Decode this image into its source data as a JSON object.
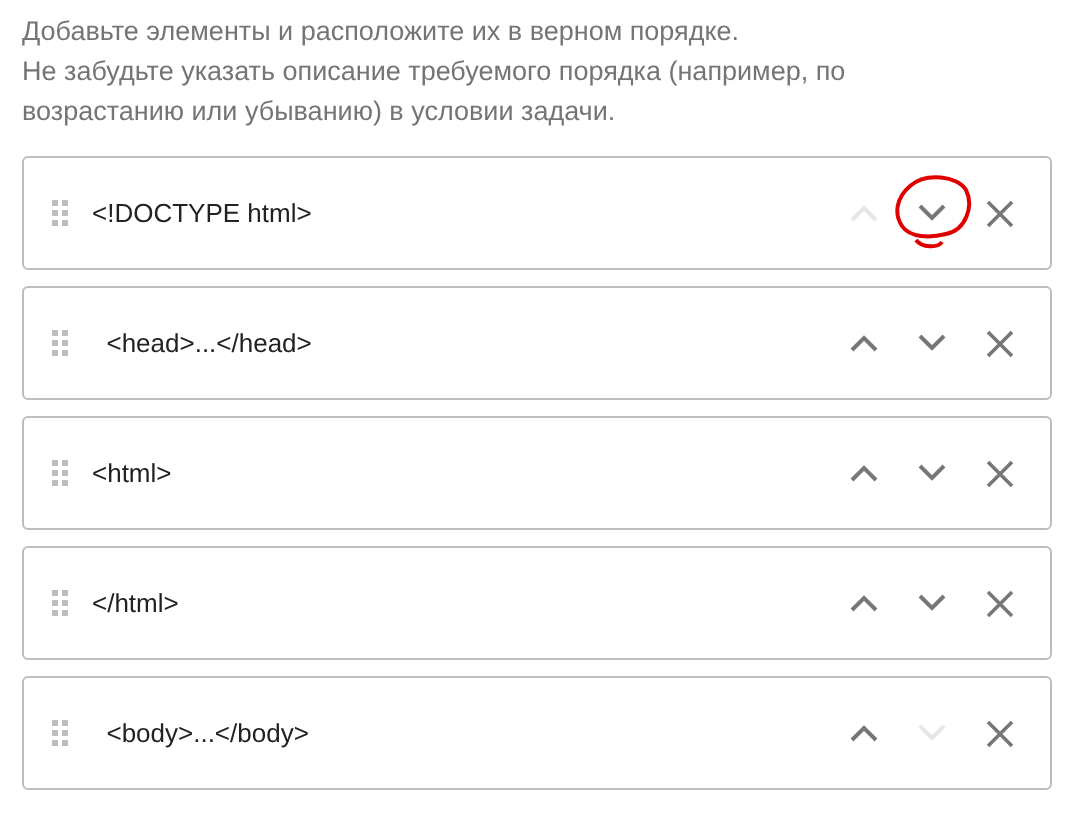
{
  "instructions": [
    "Добавьте элементы и расположите их в верном порядке.",
    "Не забудьте указать описание требуемого порядка (например, по возрастанию или убыванию) в условии задачи."
  ],
  "items": [
    {
      "text": "<!DOCTYPE html>",
      "up_disabled": true,
      "down_disabled": false,
      "down_circled": true
    },
    {
      "text": "  <head>...</head>",
      "up_disabled": false,
      "down_disabled": false,
      "down_circled": false
    },
    {
      "text": "<html>",
      "up_disabled": false,
      "down_disabled": false,
      "down_circled": false
    },
    {
      "text": "</html>",
      "up_disabled": false,
      "down_disabled": false,
      "down_circled": false
    },
    {
      "text": "  <body>...</body>",
      "up_disabled": false,
      "down_disabled": true,
      "down_circled": false
    }
  ]
}
